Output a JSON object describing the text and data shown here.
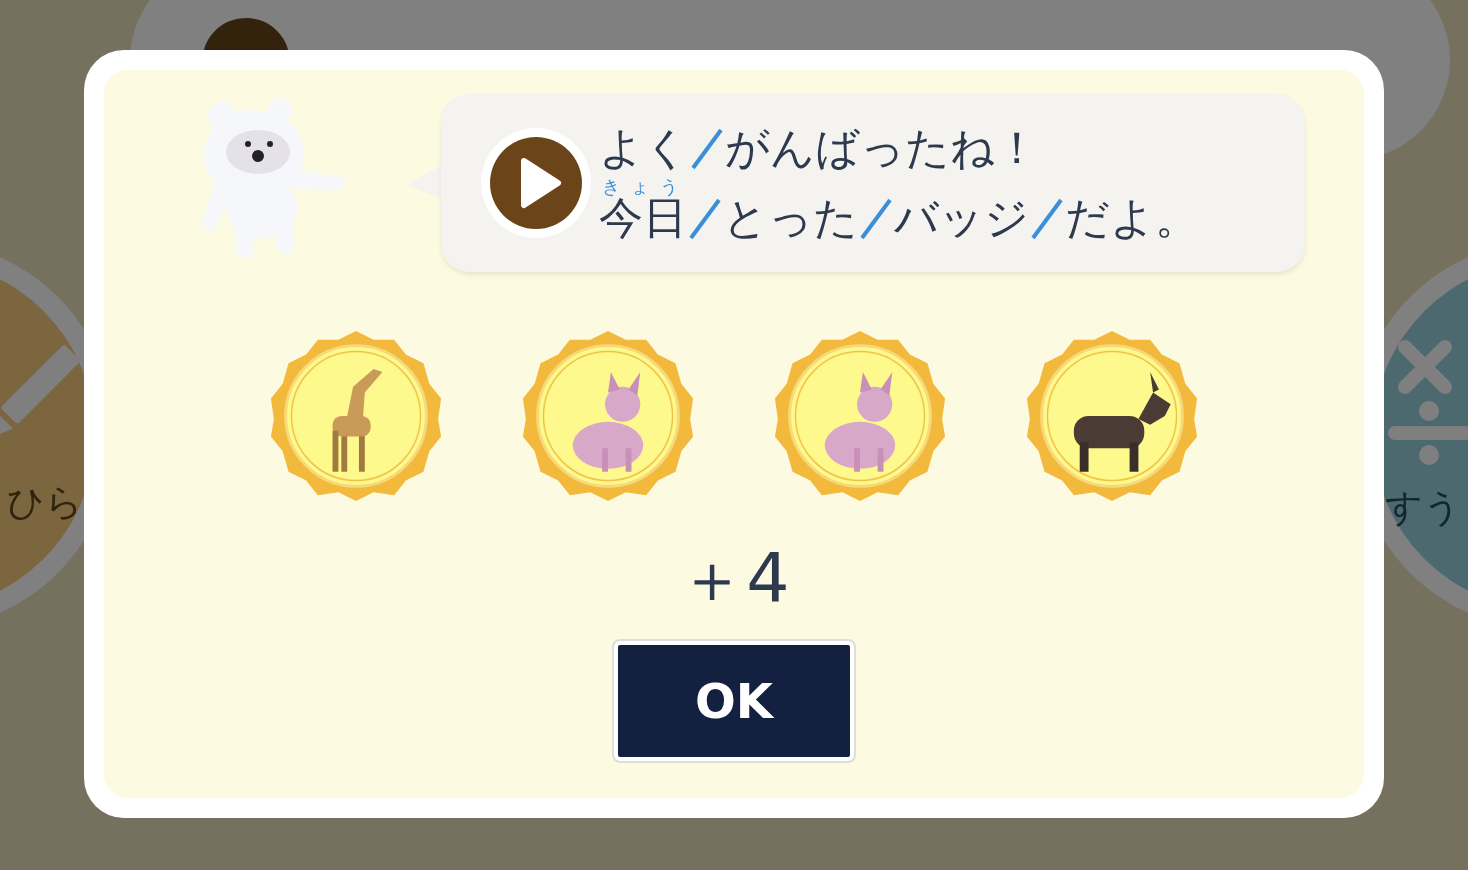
{
  "background": {
    "menu_buttons": [
      {
        "label": "ひら",
        "kind": "pencil",
        "color": "#7b6640"
      },
      {
        "label": "すう",
        "kind": "math",
        "color": "#4c6970"
      }
    ]
  },
  "dialog": {
    "speech": {
      "lines": [
        {
          "segments": [
            {
              "text": "よく"
            },
            {
              "text": "がんばったね！"
            }
          ]
        },
        {
          "segments": [
            {
              "text": "今日",
              "ruby": "きょう"
            },
            {
              "text": "とった"
            },
            {
              "text": "バッジ"
            },
            {
              "text": "だよ。"
            }
          ]
        }
      ]
    },
    "badges": [
      {
        "kind": "giraffe"
      },
      {
        "kind": "cat"
      },
      {
        "kind": "cat"
      },
      {
        "kind": "donkey"
      }
    ],
    "count": "＋4",
    "ok_button": "OK"
  }
}
